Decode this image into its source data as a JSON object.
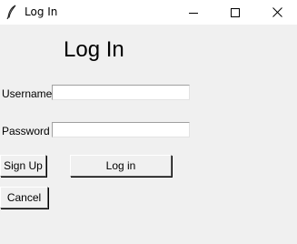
{
  "window": {
    "title": "Log In",
    "icon": "feather-icon",
    "controls": [
      "minimize-icon",
      "maximize-icon",
      "close-icon"
    ]
  },
  "form": {
    "heading": "Log In",
    "username_label": "Username",
    "username_value": "",
    "password_label": "Password",
    "password_value": ""
  },
  "buttons": {
    "signup": "Sign Up",
    "login": "Log in",
    "cancel": "Cancel"
  }
}
